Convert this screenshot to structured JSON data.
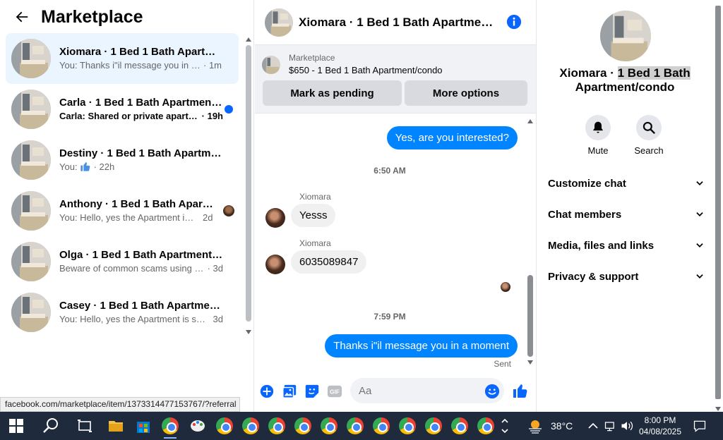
{
  "left_panel": {
    "title": "Marketplace",
    "conversations": [
      {
        "name": "Xiomara · 1 Bed 1 Bath Apartment/condo",
        "snippet": "You: Thanks i\"il message you in a moment",
        "time": "· 1m",
        "active": true
      },
      {
        "name": "Carla · 1 Bed 1 Bath Apartment/condo",
        "snippet": "Carla: Shared or private apartment?",
        "time": "· 19h",
        "unread": true
      },
      {
        "name": "Destiny · 1 Bed 1 Bath Apartment/condo",
        "snippet": "You:",
        "time": "· 22h"
      },
      {
        "name": "Anthony · 1 Bed 1 Bath Apartment/condo",
        "snippet": "You: Hello, yes the Apartment is still available",
        "time": "2d"
      },
      {
        "name": "Olga · 1 Bed 1 Bath Apartment/condo",
        "snippet": "Beware of common scams using payment apps",
        "time": "· 3d"
      },
      {
        "name": "Casey · 1 Bed 1 Bath Apartment/condo",
        "snippet": "You: Hello, yes the Apartment is still available",
        "time": "3d"
      }
    ],
    "status_url": "facebook.com/marketplace/item/1373314477153767/?referral"
  },
  "chat": {
    "title": "Xiomara · 1 Bed 1 Bath Apartment/condo",
    "listing_label": "Marketplace",
    "listing_price": "$650 - 1 Bed 1 Bath Apartment/condo",
    "mark_pending": "Mark as pending",
    "more_options": "More options",
    "messages": {
      "out1": "Yes, are you interested?",
      "time1": "6:50 AM",
      "sender1": "Xiomara",
      "in1": "Yesss",
      "sender2": "Xiomara",
      "in2": "6035089847",
      "time2": "7:59 PM",
      "out2": "Thanks i\"il message you in a moment",
      "sent": "Sent"
    },
    "composer_placeholder": "Aa"
  },
  "right_panel": {
    "name_prefix": "Xiomara · ",
    "name_highlight_1": "1 Bed 1 Bath",
    "name_line2": "Apartment/condo",
    "actions": {
      "mute": "Mute",
      "search": "Search"
    },
    "sections": [
      "Customize chat",
      "Chat members",
      "Media, files and links",
      "Privacy & support"
    ]
  },
  "taskbar": {
    "temperature": "38°C",
    "time": "8:00 PM",
    "date": "04/08/2025"
  },
  "colors": {
    "accent": "#0084ff",
    "active_row": "#ebf5ff",
    "taskbar": "#1f2a3c"
  }
}
